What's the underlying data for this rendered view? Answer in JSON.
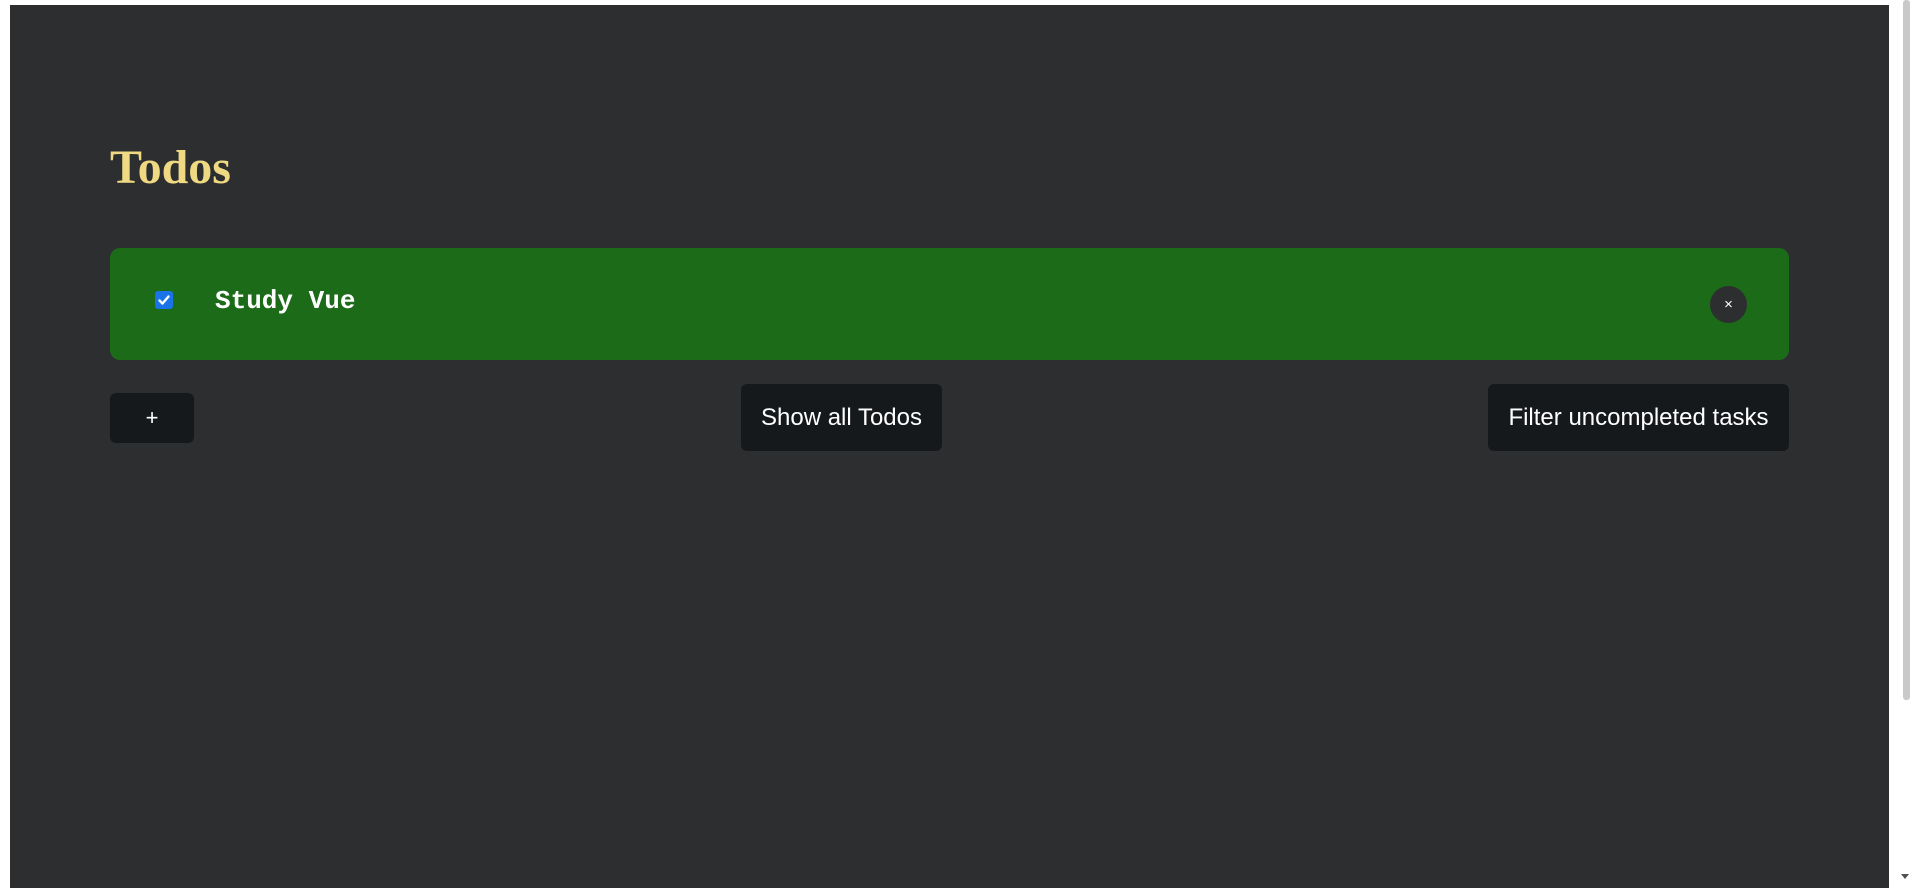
{
  "page": {
    "title": "Todos"
  },
  "todos": [
    {
      "text": "Study Vue",
      "completed": true,
      "delete_label": "×"
    }
  ],
  "controls": {
    "add_label": "+",
    "show_all_label": "Show all Todos",
    "filter_label": "Filter uncompleted tasks"
  },
  "colors": {
    "background": "#2d2e30",
    "title": "#efd982",
    "todo_completed_bg": "#1b6b18",
    "button_bg": "#16191c",
    "checkbox_accent": "#1a73e8"
  }
}
